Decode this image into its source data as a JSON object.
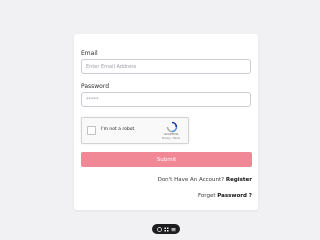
{
  "form": {
    "email_label": "Email",
    "email_placeholder": "Enter Email Address",
    "password_label": "Password",
    "password_placeholder": "*****",
    "captcha_label": "I'm not a robot",
    "captcha_brand": "reCAPTCHA",
    "captcha_terms": "Privacy - Terms",
    "submit_label": "Submit",
    "register_prompt": "Don't Have An Account?",
    "register_link": "Register",
    "forgot_prompt": "Forget",
    "forgot_link": "Password ?"
  },
  "toolbar": {
    "icons": [
      "chat-icon",
      "grid-icon",
      "menu-icon"
    ]
  },
  "colors": {
    "background": "#f1f1f3",
    "card": "#ffffff",
    "submit": "#f08896",
    "toolbar": "#1d1d1f"
  }
}
